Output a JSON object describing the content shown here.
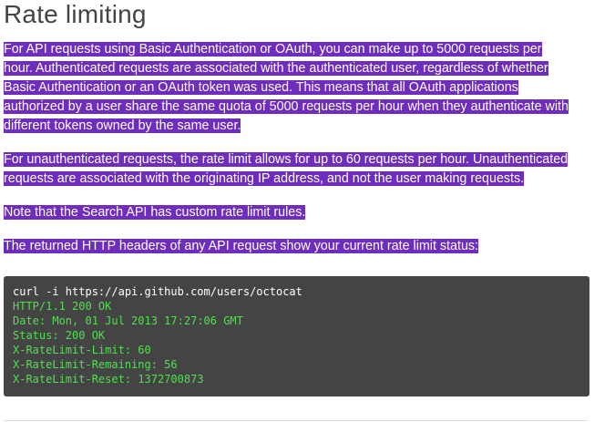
{
  "heading": "Rate limiting",
  "paragraphs": [
    "For API requests using Basic Authentication or OAuth, you can make up to 5000 requests per hour. Authenticated requests are associated with the authenticated user, regardless of whether Basic Authentication or an OAuth token was used. This means that all OAuth applications authorized by a user share the same quota of 5000 requests per hour when they authenticate with different tokens owned by the same user.",
    "For unauthenticated requests, the rate limit allows for up to 60 requests per hour. Unauthenticated requests are associated with the originating IP address, and not the user making requests.",
    "Note that the Search API has custom rate limit rules.",
    "The returned HTTP headers of any API request show your current rate limit status:"
  ],
  "code": {
    "command": "curl -i https://api.github.com/users/octocat",
    "output": [
      "HTTP/1.1 200 OK",
      "Date: Mon, 01 Jul 2013 17:27:06 GMT",
      "Status: 200 OK",
      "X-RateLimit-Limit: 60",
      "X-RateLimit-Remaining: 56",
      "X-RateLimit-Reset: 1372700873"
    ]
  },
  "colors": {
    "selection_highlight": "#6f2dbd",
    "code_background": "#444444",
    "code_output": "#4fe04f"
  }
}
